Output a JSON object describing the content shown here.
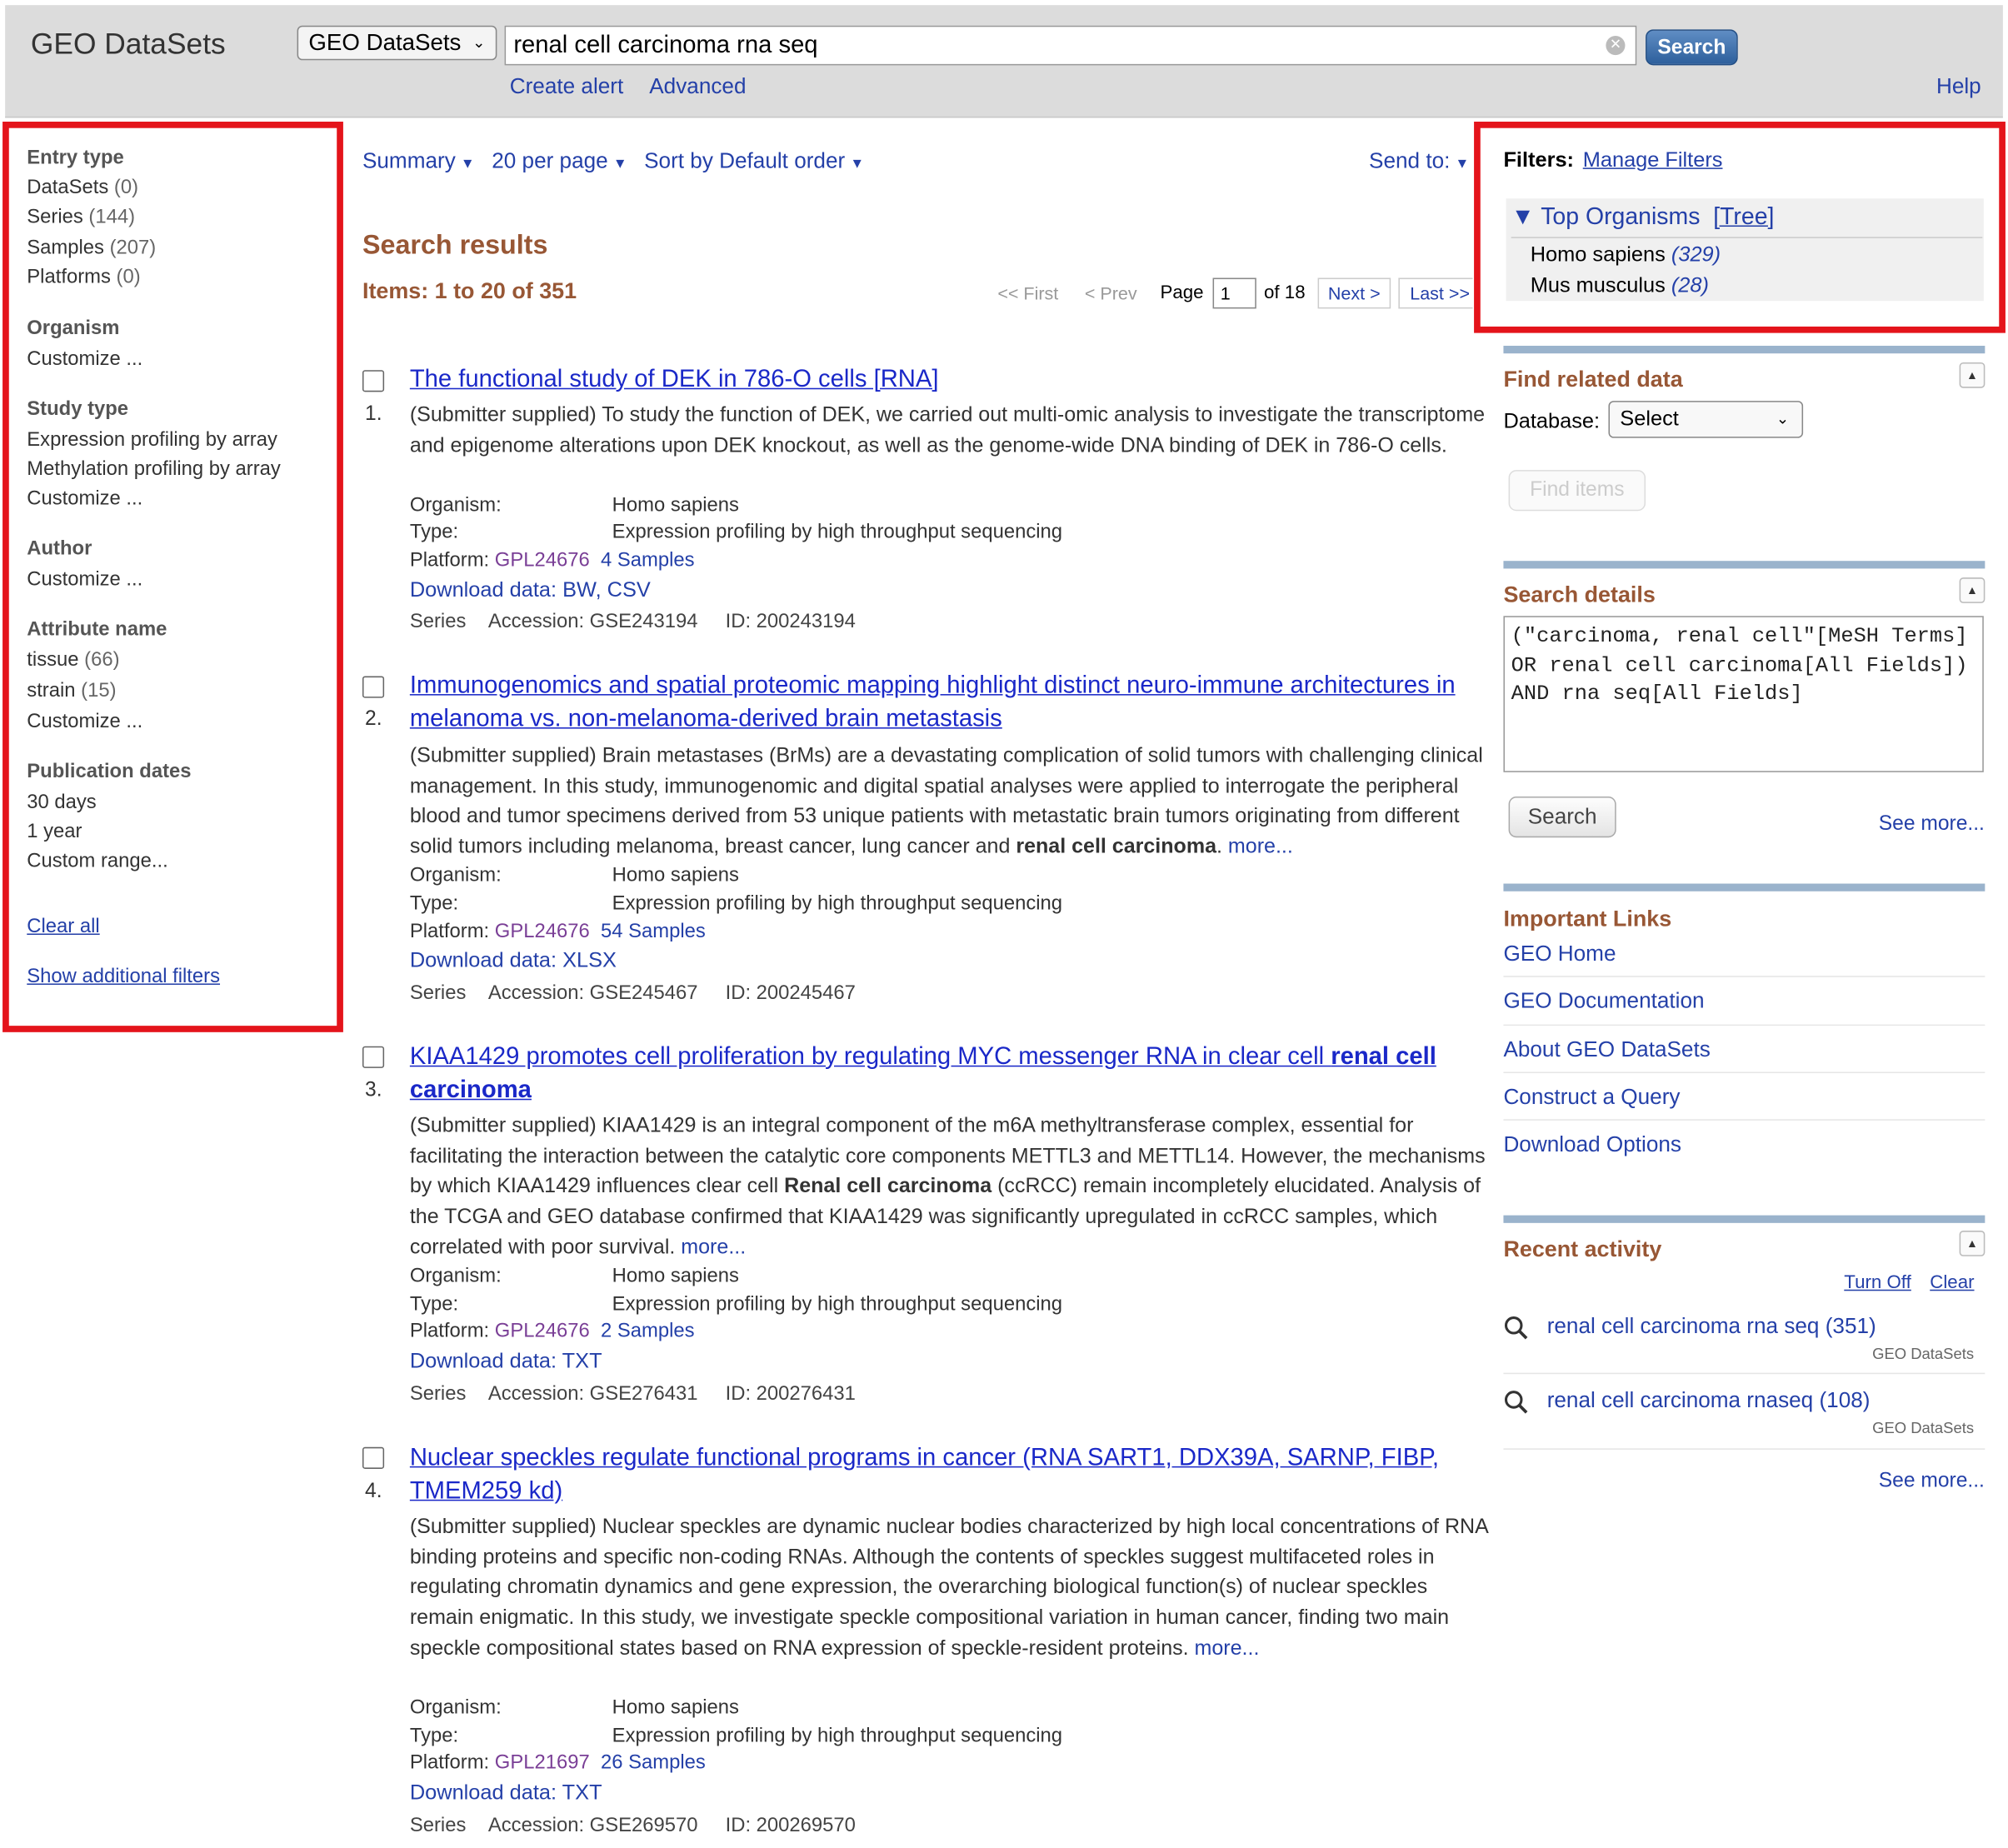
{
  "header": {
    "logo": "GEO DataSets",
    "db_select": "GEO DataSets",
    "search_value": "renal cell carcinoma rna seq",
    "search_button": "Search",
    "create_alert": "Create alert",
    "advanced": "Advanced",
    "help": "Help"
  },
  "left_filters": {
    "entry_type": {
      "heading": "Entry type",
      "items": [
        {
          "label": "DataSets",
          "count": "(0)"
        },
        {
          "label": "Series",
          "count": "(144)"
        },
        {
          "label": "Samples",
          "count": "(207)"
        },
        {
          "label": "Platforms",
          "count": "(0)"
        }
      ]
    },
    "organism": {
      "heading": "Organism",
      "customize": "Customize ..."
    },
    "study_type": {
      "heading": "Study type",
      "items": [
        "Expression profiling by array",
        "Methylation profiling by array"
      ],
      "customize": "Customize ..."
    },
    "author": {
      "heading": "Author",
      "customize": "Customize ..."
    },
    "attribute_name": {
      "heading": "Attribute name",
      "items": [
        {
          "label": "tissue",
          "count": "(66)"
        },
        {
          "label": "strain",
          "count": "(15)"
        }
      ],
      "customize": "Customize ..."
    },
    "publication_dates": {
      "heading": "Publication dates",
      "items": [
        "30 days",
        "1 year",
        "Custom range..."
      ]
    },
    "clear_all": "Clear all",
    "show_additional": "Show additional filters"
  },
  "toolbar": {
    "summary": "Summary",
    "per_page": "20 per page",
    "sort": "Sort by Default order",
    "send_to": "Send to:"
  },
  "results": {
    "title": "Search results",
    "items_line": "Items: 1 to 20 of 351",
    "pagination": {
      "first": "<< First",
      "prev": "< Prev",
      "page_label": "Page",
      "page_value": "1",
      "of": "of 18",
      "next": "Next >",
      "last": "Last >>"
    },
    "labels": {
      "organism": "Organism:",
      "type": "Type:",
      "platform": "Platform:",
      "series": "Series",
      "more": "more..."
    },
    "items": [
      {
        "num": "1.",
        "title": "The functional study of DEK in 786-O cells [RNA]",
        "desc": "(Submitter supplied) To study the function of DEK, we carried out multi-omic analysis to investigate the transcriptome and epigenome alterations upon DEK knockout, as well as the genome-wide DNA binding of DEK in 786-O cells.",
        "organism": "Homo sapiens",
        "type": "Expression profiling by high throughput sequencing",
        "platform": "GPL24676",
        "samples": "4 Samples",
        "download": "Download data: BW, CSV",
        "accession": "Accession: GSE243194",
        "id": "ID: 200243194"
      },
      {
        "num": "2.",
        "title": "Immunogenomics and spatial proteomic mapping highlight distinct neuro-immune architectures in melanoma vs. non-melanoma-derived brain metastasis",
        "desc_a": "(Submitter supplied) Brain metastases (BrMs) are a devastating complication of solid tumors with challenging clinical management. In this study, immunogenomic and digital spatial analyses were applied to interrogate the peripheral blood and tumor specimens derived from 53 unique patients with metastatic brain tumors originating from different solid tumors including melanoma, breast cancer, lung cancer and ",
        "desc_bold": "renal cell carcinoma",
        "desc_b": ". ",
        "organism": "Homo sapiens",
        "type": "Expression profiling by high throughput sequencing",
        "platform": "GPL24676",
        "samples": "54 Samples",
        "download": "Download data: XLSX",
        "accession": "Accession: GSE245467",
        "id": "ID: 200245467"
      },
      {
        "num": "3.",
        "title_a": "KIAA1429 promotes cell proliferation by regulating MYC messenger RNA in clear cell ",
        "title_bold": "renal cell carcinoma",
        "desc_a": "(Submitter supplied) KIAA1429 is an integral component of the m6A methyltransferase complex, essential for facilitating the interaction between the catalytic core components METTL3 and METTL14. However, the mechanisms by which KIAA1429 influences clear cell ",
        "desc_bold": "Renal cell carcinoma",
        "desc_b": " (ccRCC) remain incompletely elucidated. Analysis of the TCGA and GEO database confirmed that KIAA1429 was significantly upregulated in ccRCC samples, which correlated with poor survival. ",
        "organism": "Homo sapiens",
        "type": "Expression profiling by high throughput sequencing",
        "platform": "GPL24676",
        "samples": "2 Samples",
        "download": "Download data: TXT",
        "accession": "Accession: GSE276431",
        "id": "ID: 200276431"
      },
      {
        "num": "4.",
        "title": "Nuclear speckles regulate functional programs in cancer (RNA SART1, DDX39A, SARNP, FIBP, TMEM259 kd)",
        "desc": "(Submitter supplied) Nuclear speckles are dynamic nuclear bodies characterized by high local concentrations of RNA binding proteins and specific non-coding RNAs. Although the contents of speckles suggest multifaceted roles in regulating chromatin dynamics and gene expression, the overarching biological function(s) of nuclear speckles remain enigmatic. In this study, we investigate speckle compositional variation in human cancer, finding two main speckle compositional states based on RNA expression of speckle-resident proteins. ",
        "organism": "Homo sapiens",
        "type": "Expression profiling by high throughput sequencing",
        "platform": "GPL21697",
        "samples": "26 Samples",
        "download": "Download data: TXT",
        "accession": "Accession: GSE269570",
        "id": "ID: 200269570"
      }
    ]
  },
  "right": {
    "filters_label": "Filters:",
    "manage_filters": "Manage Filters",
    "top_organisms": "Top Organisms",
    "tree": "[Tree]",
    "organisms": [
      {
        "name": "Homo sapiens",
        "count": "(329)"
      },
      {
        "name": "Mus musculus",
        "count": "(28)"
      }
    ],
    "find_related": {
      "title": "Find related data",
      "database_label": "Database:",
      "select": "Select",
      "find_items": "Find items"
    },
    "search_details": {
      "title": "Search details",
      "query": "(\"carcinoma, renal cell\"[MeSH Terms] OR renal cell carcinoma[All Fields]) AND rna seq[All Fields]",
      "search": "Search",
      "see_more": "See more..."
    },
    "important_links": {
      "title": "Important Links",
      "links": [
        "GEO Home",
        "GEO Documentation",
        "About GEO DataSets",
        "Construct a Query",
        "Download Options"
      ]
    },
    "recent_activity": {
      "title": "Recent activity",
      "turn_off": "Turn Off",
      "clear": "Clear",
      "items": [
        {
          "query": "renal cell carcinoma rna seq (351)",
          "db": "GEO DataSets"
        },
        {
          "query": "renal cell carcinoma rnaseq (108)",
          "db": "GEO DataSets"
        }
      ],
      "see_more": "See more..."
    }
  },
  "colors": {
    "highlight_border": "#e4141b",
    "link": "#2440a8",
    "heading": "#985735",
    "title_link": "#1a28c8",
    "platform": "#7a3f96"
  }
}
